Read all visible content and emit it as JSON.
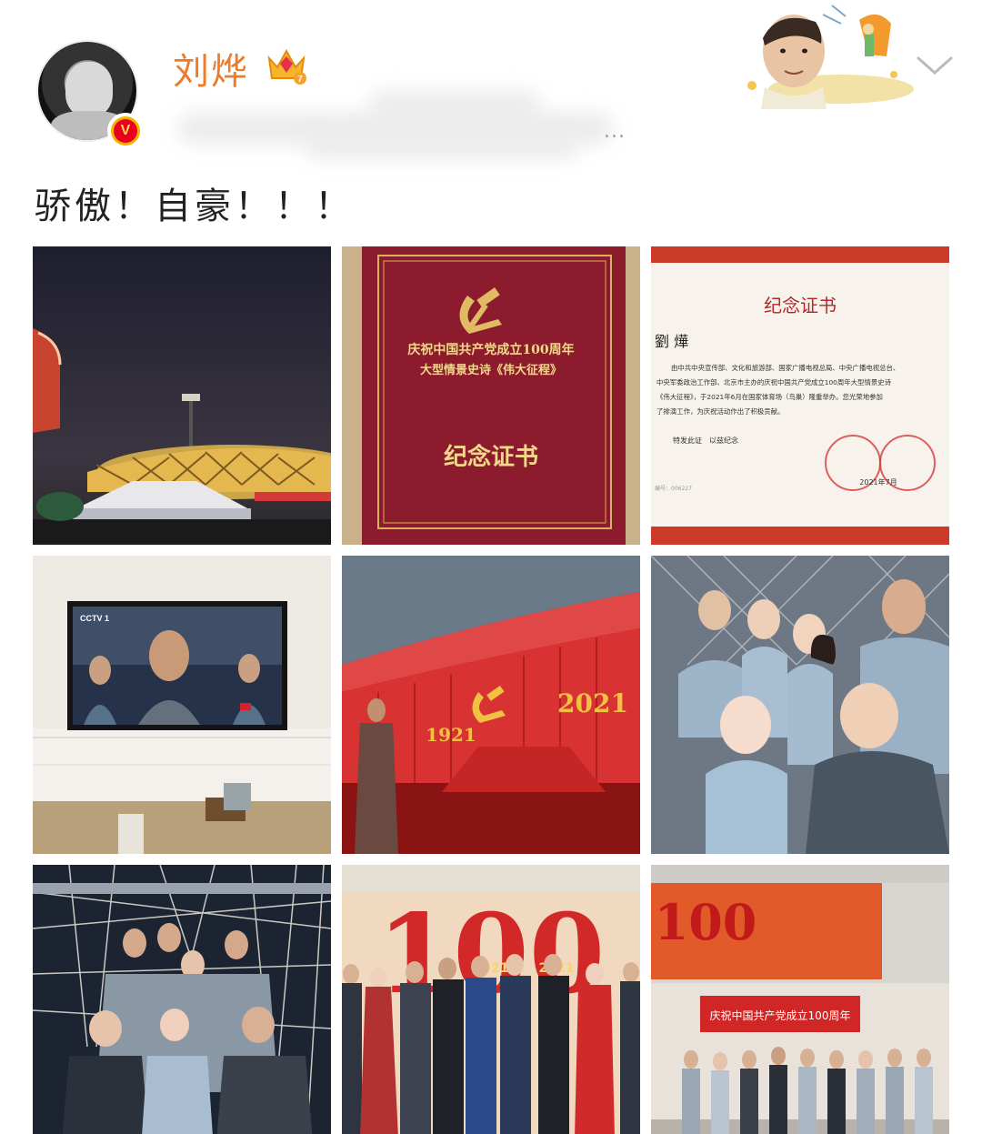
{
  "user": {
    "name": "刘烨",
    "verified_badge": "V",
    "vip_level": "7",
    "avatar_icon": "avatar-child-photo",
    "subtitle_dots": "..."
  },
  "post": {
    "text": "骄傲！自豪！！！"
  },
  "colors": {
    "username": "#ee7b2a",
    "badge_red": "#e8001c",
    "badge_gold": "#f5b400"
  },
  "photos": {
    "p2": {
      "line1": "庆祝中国共产党成立100周年",
      "line2": "大型情景史诗《伟大征程》",
      "title": "纪念证书"
    },
    "p3": {
      "title": "纪念证书",
      "name": "劉 燁",
      "body1": "由中共中央宣传部、文化和旅游部、国家广播电视总局、中央广播电视总台、",
      "body2": "中央军委政治工作部、北京市主办的庆祝中国共产党成立100周年大型情景史诗",
      "body3": "《伟大征程》，于2021年6月在国家体育场（鸟巢）隆重举办。您光荣地参加",
      "body4": "了排演工作，为庆祝活动作出了积极贡献。",
      "closing": "特发此证　以兹纪念",
      "number": "编号：006227",
      "date": "2021年7月"
    },
    "p4": {
      "channel": "CCTV 1"
    },
    "p5": {
      "year_left": "1921",
      "year_right": "2021"
    },
    "p8": {
      "big": "100",
      "year_left": "1921",
      "year_right": "2021"
    },
    "p9": {
      "banner": "庆祝中国共产党成立100周年",
      "big": "100"
    }
  }
}
